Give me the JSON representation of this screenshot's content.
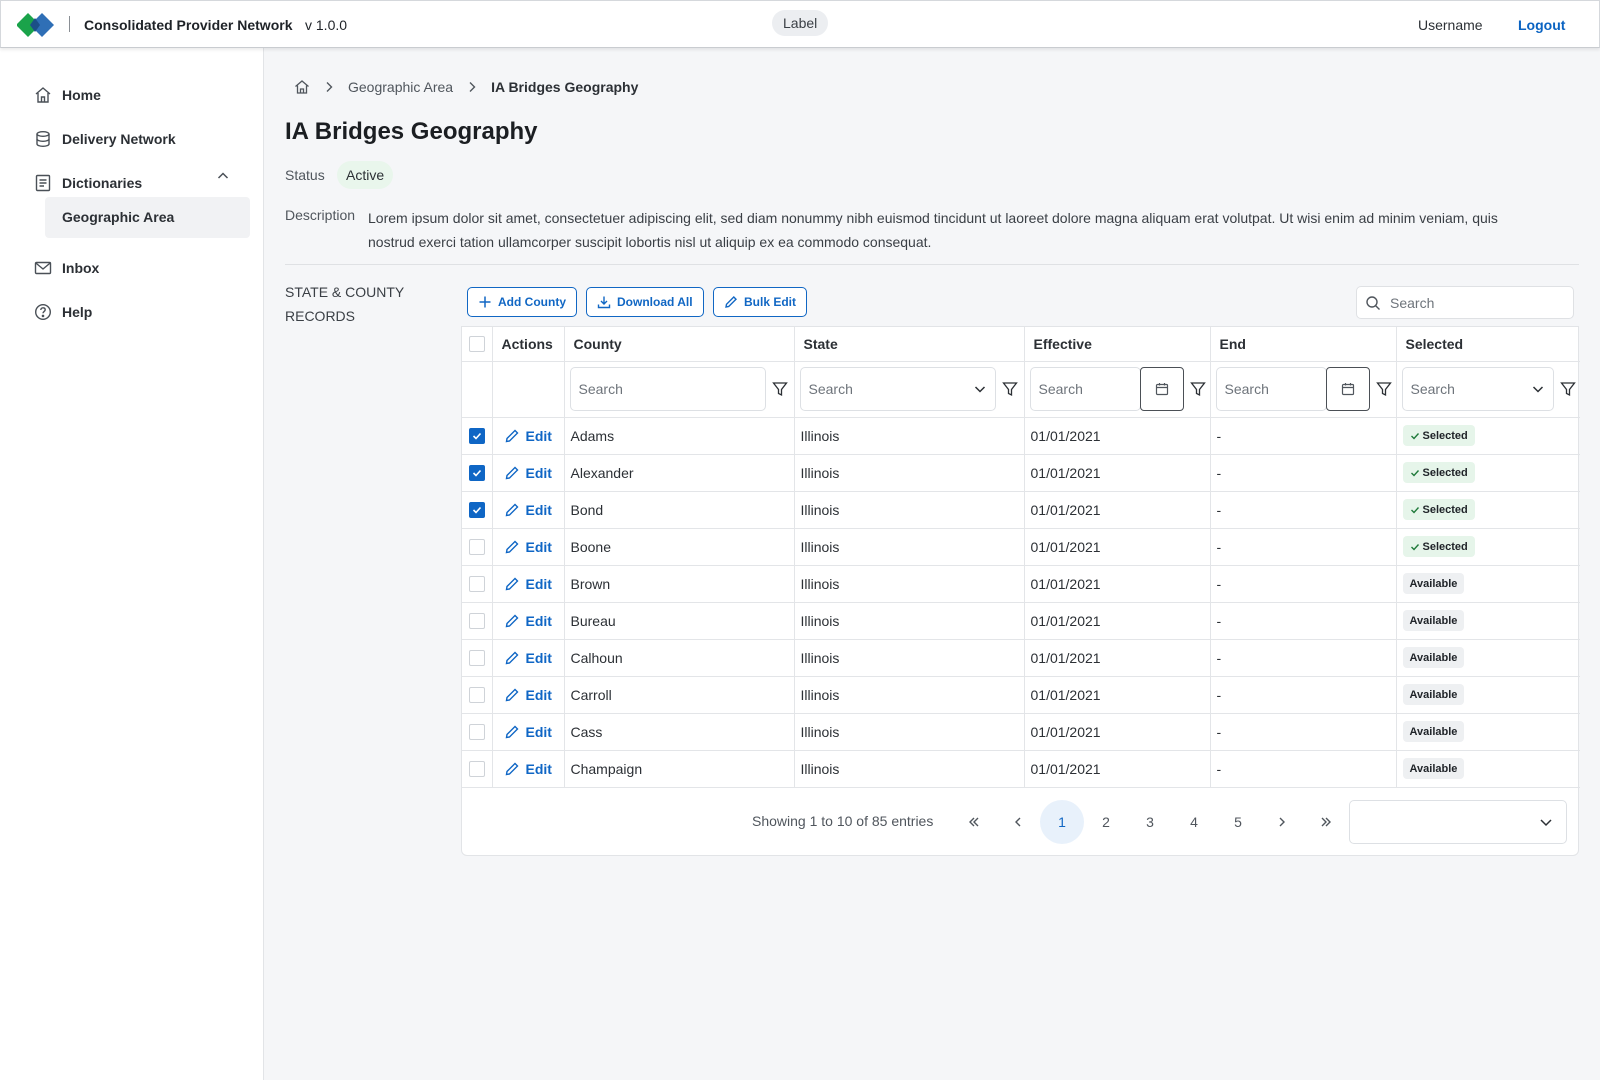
{
  "topbar": {
    "app_name": "Consolidated Provider Network",
    "version": "v 1.0.0",
    "label": "Label",
    "username": "Username",
    "logout": "Logout"
  },
  "sidebar": {
    "items": [
      {
        "label": "Home",
        "icon": "home-icon"
      },
      {
        "label": "Delivery Network",
        "icon": "database-icon"
      },
      {
        "label": "Dictionaries",
        "icon": "document-icon"
      },
      {
        "label": "Inbox",
        "icon": "mail-icon"
      },
      {
        "label": "Help",
        "icon": "help-icon"
      }
    ],
    "subitem": "Geographic Area"
  },
  "breadcrumb": {
    "items": [
      "Geographic Area",
      "IA Bridges Geography"
    ]
  },
  "page": {
    "title": "IA Bridges Geography",
    "status_label": "Status",
    "status": "Active",
    "description_label": "Description",
    "description": "Lorem ipsum dolor sit amet, consectetuer adipiscing elit, sed diam nonummy nibh euismod tincidunt ut laoreet dolore magna aliquam erat volutpat. Ut wisi enim ad minim veniam, quis nostrud exerci tation ullamcorper suscipit lobortis nisl ut aliquip ex ea commodo consequat.",
    "records_label": "STATE & COUNTY RECORDS"
  },
  "toolbar": {
    "add_county": "Add County",
    "download_all": "Download All",
    "bulk_edit": "Bulk Edit",
    "search_placeholder": "Search"
  },
  "table": {
    "columns": [
      "Actions",
      "County",
      "State",
      "Effective",
      "End",
      "Selected"
    ],
    "filter_placeholder": "Search",
    "edit_label": "Edit",
    "rows": [
      {
        "checked": true,
        "county": "Adams",
        "state": "Illinois",
        "effective": "01/01/2021",
        "end": "-",
        "selected": "Selected"
      },
      {
        "checked": true,
        "county": "Alexander",
        "state": "Illinois",
        "effective": "01/01/2021",
        "end": "-",
        "selected": "Selected"
      },
      {
        "checked": true,
        "county": "Bond",
        "state": "Illinois",
        "effective": "01/01/2021",
        "end": "-",
        "selected": "Selected"
      },
      {
        "checked": false,
        "county": "Boone",
        "state": "Illinois",
        "effective": "01/01/2021",
        "end": "-",
        "selected": "Selected"
      },
      {
        "checked": false,
        "county": "Brown",
        "state": "Illinois",
        "effective": "01/01/2021",
        "end": "-",
        "selected": "Available"
      },
      {
        "checked": false,
        "county": "Bureau",
        "state": "Illinois",
        "effective": "01/01/2021",
        "end": "-",
        "selected": "Available"
      },
      {
        "checked": false,
        "county": "Calhoun",
        "state": "Illinois",
        "effective": "01/01/2021",
        "end": "-",
        "selected": "Available"
      },
      {
        "checked": false,
        "county": "Carroll",
        "state": "Illinois",
        "effective": "01/01/2021",
        "end": "-",
        "selected": "Available"
      },
      {
        "checked": false,
        "county": "Cass",
        "state": "Illinois",
        "effective": "01/01/2021",
        "end": "-",
        "selected": "Available"
      },
      {
        "checked": false,
        "county": "Champaign",
        "state": "Illinois",
        "effective": "01/01/2021",
        "end": "-",
        "selected": "Available"
      }
    ]
  },
  "pagination": {
    "info": "Showing 1 to 10 of 85 entries",
    "pages": [
      "1",
      "2",
      "3",
      "4",
      "5"
    ],
    "current": "1"
  },
  "colors": {
    "accent": "#0f66c5",
    "logo_green": "#1aa34a",
    "logo_blue": "#2f6fb6",
    "selected_chip": "#e6f5ea",
    "active_badge": "#e9f6ec"
  }
}
